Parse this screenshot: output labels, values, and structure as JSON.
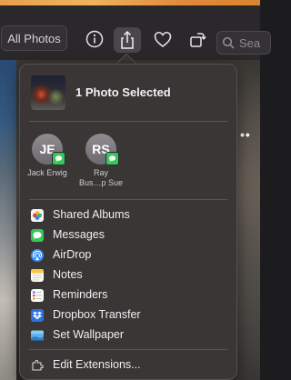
{
  "toolbar": {
    "view_button": "All Photos",
    "search_placeholder": "Sea"
  },
  "share_menu": {
    "selection_title": "1 Photo Selected",
    "contacts": [
      {
        "initials": "JE",
        "name": "Jack Erwig"
      },
      {
        "initials": "RS",
        "name": "Ray\nBus…p Sue"
      }
    ],
    "items": [
      {
        "label": "Shared Albums",
        "icon": "shared-albums-icon"
      },
      {
        "label": "Messages",
        "icon": "messages-icon"
      },
      {
        "label": "AirDrop",
        "icon": "airdrop-icon"
      },
      {
        "label": "Notes",
        "icon": "notes-icon"
      },
      {
        "label": "Reminders",
        "icon": "reminders-icon"
      },
      {
        "label": "Dropbox Transfer",
        "icon": "dropbox-icon"
      },
      {
        "label": "Set Wallpaper",
        "icon": "wallpaper-icon"
      }
    ],
    "footer_item": {
      "label": "Edit Extensions...",
      "icon": "extensions-icon"
    }
  },
  "colors": {
    "messages_green": "#34c759",
    "airdrop_blue": "#3a8cf6",
    "notes_yellow": "#f5c943",
    "dropbox_blue": "#2f6fe4"
  }
}
